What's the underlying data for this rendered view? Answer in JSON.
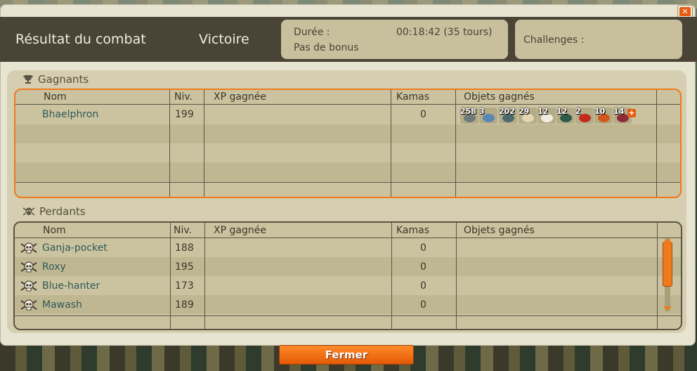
{
  "header": {
    "title": "Résultat du combat",
    "result": "Victoire",
    "duration_label": "Durée :",
    "duration_value": "00:18:42 (35 tours)",
    "bonus": "Pas de bonus",
    "challenges_label": "Challenges :"
  },
  "columns": {
    "name": "Nom",
    "level": "Niv.",
    "xp": "XP gagnée",
    "kamas": "Kamas",
    "items": "Objets gagnés"
  },
  "winners": {
    "label": "Gagnants",
    "rows": [
      {
        "name": "Bhaelphron",
        "level": "199",
        "xp": "",
        "kamas": "0",
        "items": [
          {
            "qty": "258",
            "icon": "resource-item-gray"
          },
          {
            "qty": "3",
            "icon": "resource-item-blue"
          },
          {
            "qty": "202",
            "icon": "resource-item-teal"
          },
          {
            "qty": "29",
            "icon": "resource-item-cream"
          },
          {
            "qty": "12",
            "icon": "resource-item-white"
          },
          {
            "qty": "12",
            "icon": "resource-item-green"
          },
          {
            "qty": "2",
            "icon": "resource-item-red"
          },
          {
            "qty": "10",
            "icon": "resource-item-orange"
          },
          {
            "qty": "14",
            "icon": "resource-item-crimson"
          }
        ]
      }
    ]
  },
  "losers": {
    "label": "Perdants",
    "rows": [
      {
        "name": "Ganja-pocket",
        "level": "188",
        "xp": "",
        "kamas": "0"
      },
      {
        "name": "Roxy",
        "level": "195",
        "xp": "",
        "kamas": "0"
      },
      {
        "name": "Blue-hanter",
        "level": "173",
        "xp": "",
        "kamas": "0"
      },
      {
        "name": "Mawash",
        "level": "189",
        "xp": "",
        "kamas": "0"
      }
    ]
  },
  "footer": {
    "close_label": "Fermer"
  },
  "colors": {
    "accent": "#ef7a1a",
    "header_bg": "#4a4436",
    "panel_bg": "#d6ceb0",
    "name_link": "#2f5a56"
  }
}
